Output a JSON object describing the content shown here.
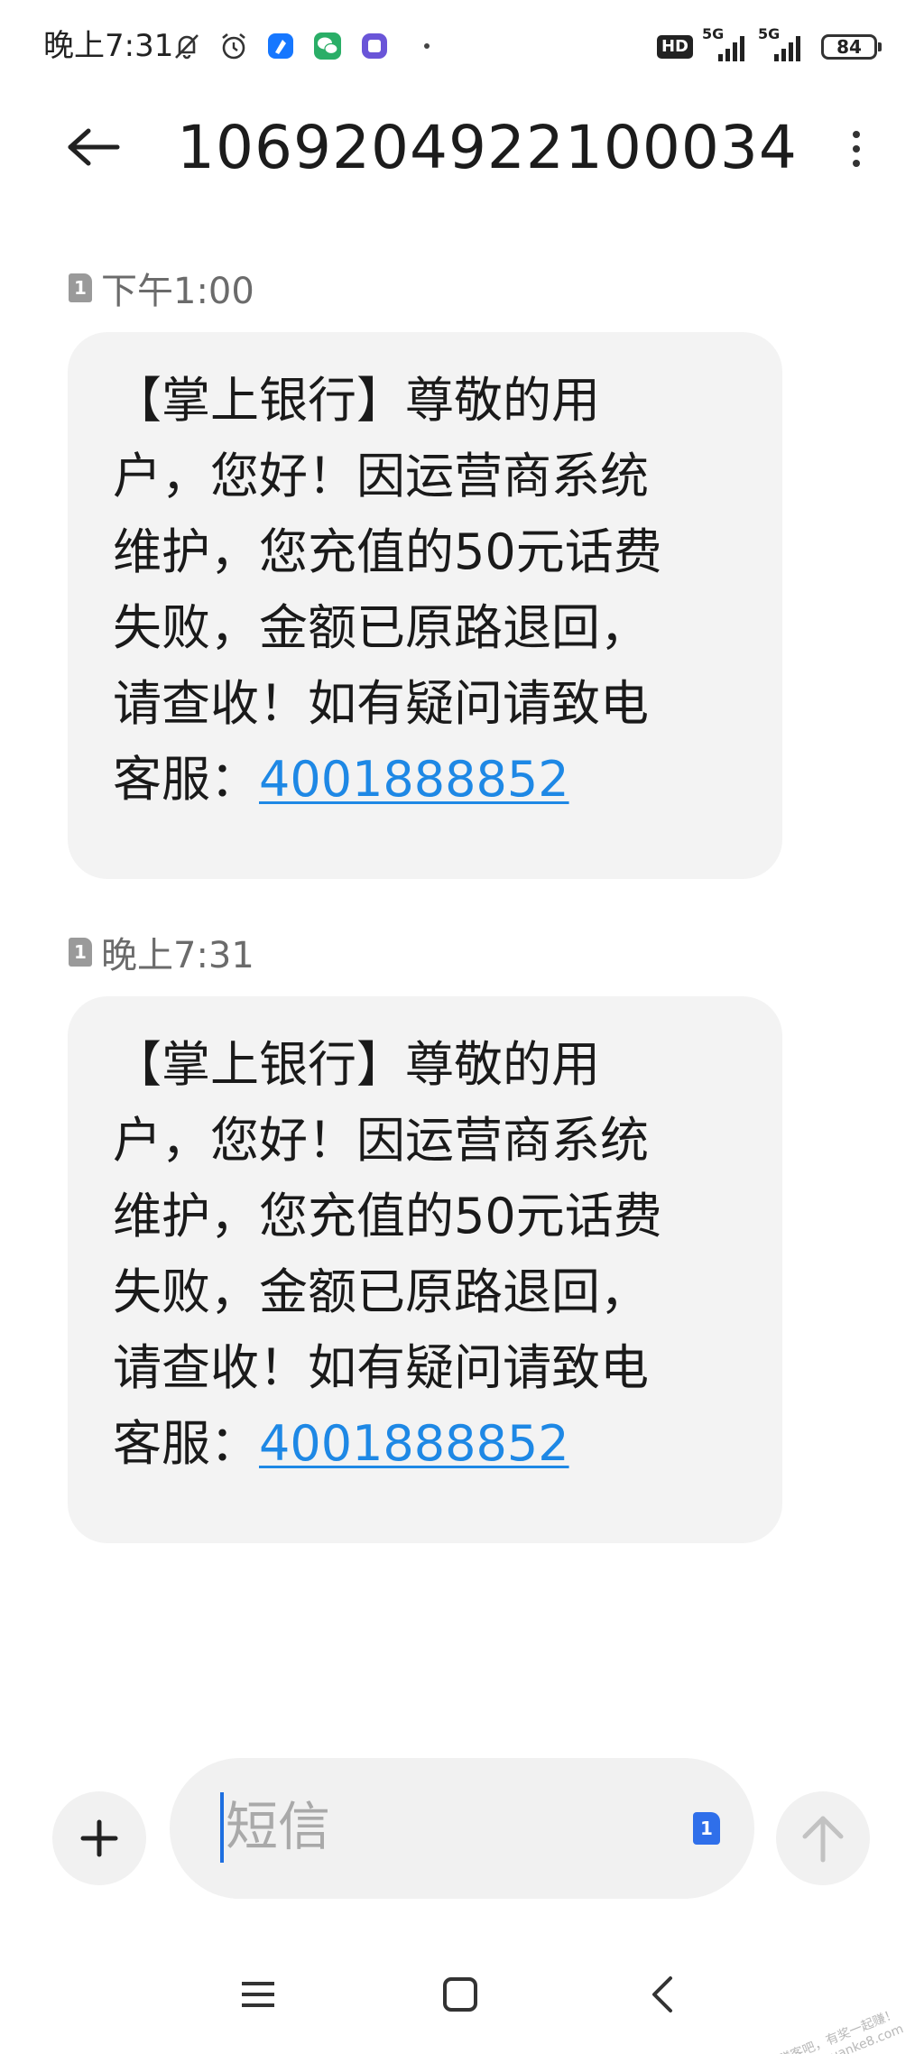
{
  "status_bar": {
    "time": "晚上7:31",
    "hd_label": "HD",
    "network_1": "5G",
    "network_2": "5G",
    "battery": "84"
  },
  "app_bar": {
    "title": "1069204922100034"
  },
  "messages": [
    {
      "sim": "1",
      "timestamp": "下午1:00",
      "lines": [
        "【掌上银行】尊敬的用",
        "户，您好！因运营商系统",
        "维护，您充值的50元话费",
        "失败，金额已原路退回，",
        "请查收！如有疑问请致电"
      ],
      "last_line_prefix": "客服：",
      "phone": "4001888852"
    },
    {
      "sim": "1",
      "timestamp": "晚上7:31",
      "lines": [
        "【掌上银行】尊敬的用",
        "户，您好！因运营商系统",
        "维护，您充值的50元话费",
        "失败，金额已原路退回，",
        "请查收！如有疑问请致电"
      ],
      "last_line_prefix": "客服：",
      "phone": "4001888852"
    }
  ],
  "composer": {
    "placeholder": "短信",
    "sim": "1"
  },
  "watermark": {
    "line1": "赚客吧，有奖一起赚！",
    "line2": "www.zuanke8.com"
  },
  "colors": {
    "link": "#1e88e5",
    "bubble": "#f3f3f3",
    "sim_active": "#2f6fea"
  }
}
